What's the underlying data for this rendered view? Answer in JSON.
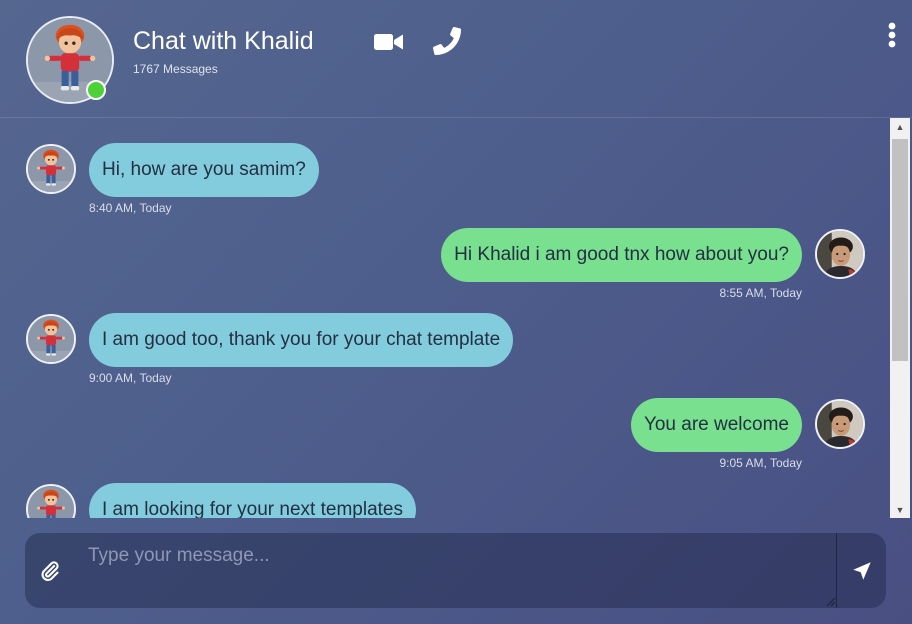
{
  "header": {
    "title": "Chat with Khalid",
    "message_count": "1767 Messages",
    "contact_avatar": "khalid-avatar",
    "status": "online",
    "icons": [
      "video-icon",
      "phone-icon",
      "more-vertical-icon"
    ]
  },
  "messages": [
    {
      "direction": "incoming",
      "sender": "Khalid",
      "text": "Hi, how are you samim?",
      "time": "8:40 AM, Today"
    },
    {
      "direction": "outgoing",
      "sender": "samim",
      "text": "Hi Khalid i am good tnx how about you?",
      "time": "8:55 AM, Today"
    },
    {
      "direction": "incoming",
      "sender": "Khalid",
      "text": "I am good too, thank you for your chat template",
      "time": "9:00 AM, Today"
    },
    {
      "direction": "outgoing",
      "sender": "samim",
      "text": "You are welcome",
      "time": "9:05 AM, Today"
    },
    {
      "direction": "incoming",
      "sender": "Khalid",
      "text": "I am looking for your next templates",
      "time": ""
    }
  ],
  "composer": {
    "placeholder": "Type your message...",
    "value": "",
    "attach_icon": "paperclip-icon",
    "send_icon": "send-icon"
  },
  "colors": {
    "incoming_bubble": "#82ccdd",
    "outgoing_bubble": "#78e08f",
    "online": "#4cd137",
    "background_start": "#55668f",
    "background_end": "#4a4f82"
  }
}
